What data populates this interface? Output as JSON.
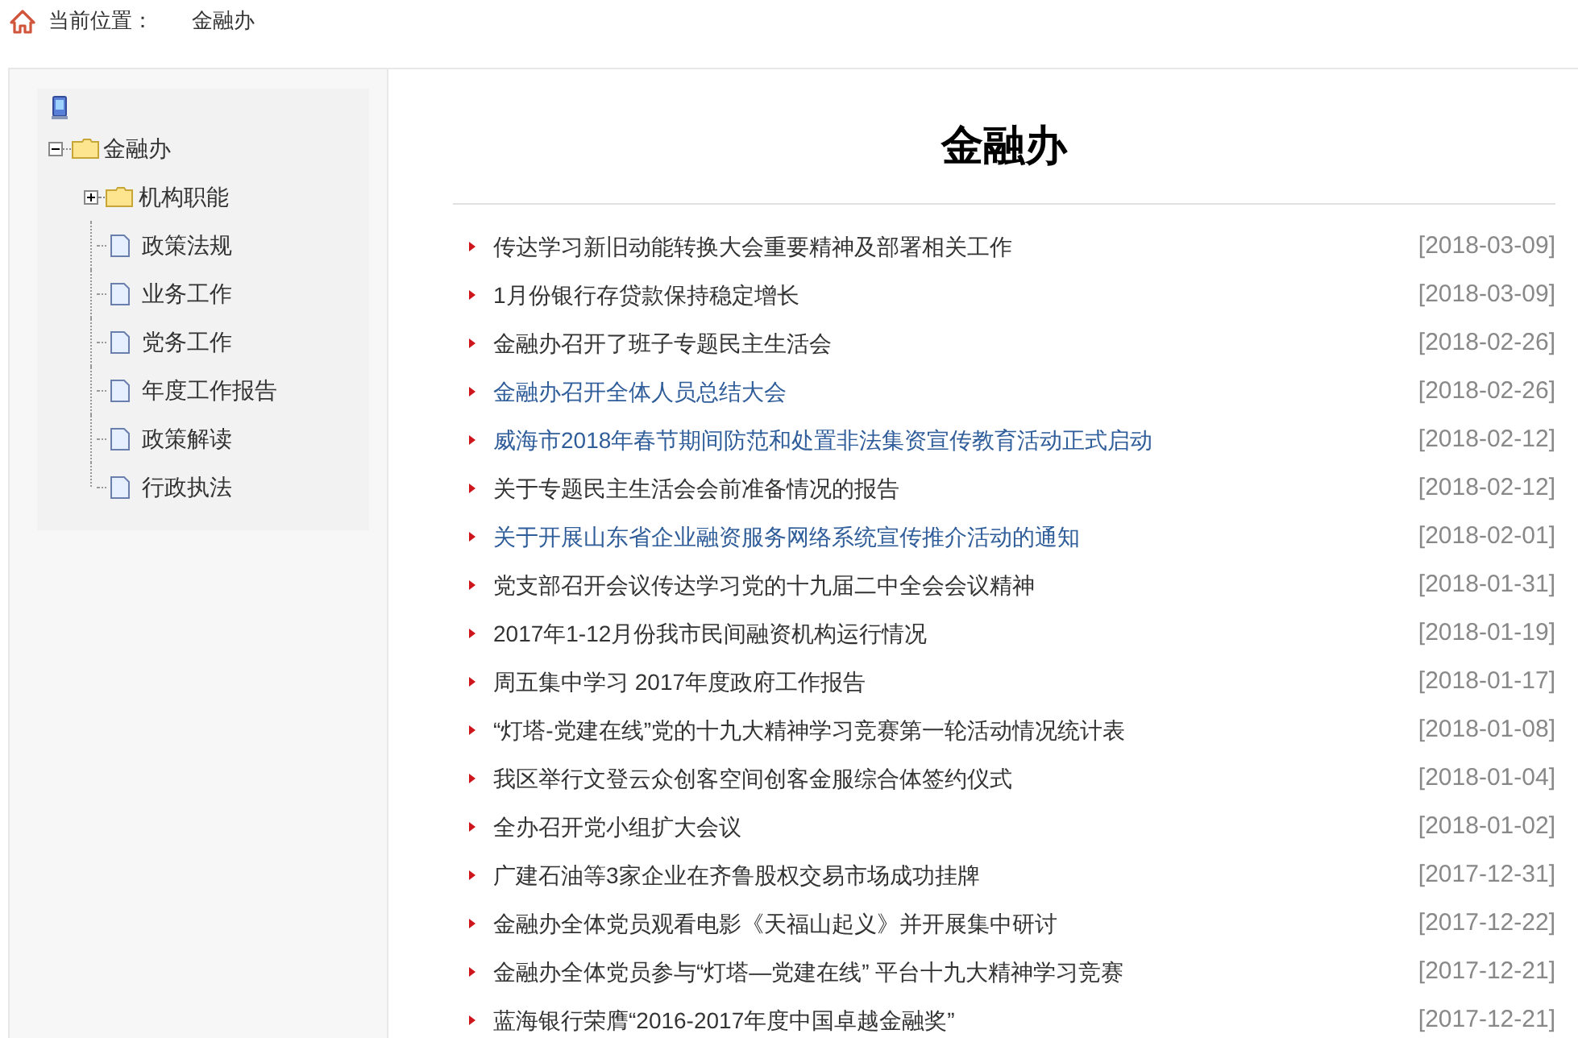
{
  "breadcrumb": {
    "label": "当前位置：",
    "current": "金融办"
  },
  "tree": {
    "label": "金融办",
    "expanded": true,
    "children": [
      {
        "label": "机构职能",
        "kind": "folder",
        "expanded": false
      },
      {
        "label": "政策法规",
        "kind": "page"
      },
      {
        "label": "业务工作",
        "kind": "page"
      },
      {
        "label": "党务工作",
        "kind": "page"
      },
      {
        "label": "年度工作报告",
        "kind": "page"
      },
      {
        "label": "政策解读",
        "kind": "page"
      },
      {
        "label": "行政执法",
        "kind": "page"
      }
    ]
  },
  "title": "金融办",
  "articles": [
    {
      "title": "传达学习新旧动能转换大会重要精神及部署相关工作",
      "date": "[2018-03-09]",
      "visited": false
    },
    {
      "title": "1月份银行存贷款保持稳定增长",
      "date": "[2018-03-09]",
      "visited": false
    },
    {
      "title": "金融办召开了班子专题民主生活会",
      "date": "[2018-02-26]",
      "visited": false
    },
    {
      "title": "金融办召开全体人员总结大会",
      "date": "[2018-02-26]",
      "visited": true
    },
    {
      "title": "威海市2018年春节期间防范和处置非法集资宣传教育活动正式启动",
      "date": "[2018-02-12]",
      "visited": true
    },
    {
      "title": "关于专题民主生活会会前准备情况的报告",
      "date": "[2018-02-12]",
      "visited": false
    },
    {
      "title": "关于开展山东省企业融资服务网络系统宣传推介活动的通知",
      "date": "[2018-02-01]",
      "visited": true
    },
    {
      "title": "党支部召开会议传达学习党的十九届二中全会会议精神",
      "date": "[2018-01-31]",
      "visited": false
    },
    {
      "title": "2017年1-12月份我市民间融资机构运行情况",
      "date": "[2018-01-19]",
      "visited": false
    },
    {
      "title": "周五集中学习 2017年度政府工作报告",
      "date": "[2018-01-17]",
      "visited": false
    },
    {
      "title": "“灯塔-党建在线”党的十九大精神学习竞赛第一轮活动情况统计表",
      "date": "[2018-01-08]",
      "visited": false
    },
    {
      "title": "我区举行文登云众创客空间创客金服综合体签约仪式",
      "date": "[2018-01-04]",
      "visited": false
    },
    {
      "title": "全办召开党小组扩大会议",
      "date": "[2018-01-02]",
      "visited": false
    },
    {
      "title": "广建石油等3家企业在齐鲁股权交易市场成功挂牌",
      "date": "[2017-12-31]",
      "visited": false
    },
    {
      "title": "金融办全体党员观看电影《天福山起义》并开展集中研讨",
      "date": "[2017-12-22]",
      "visited": false
    },
    {
      "title": "金融办全体党员参与“灯塔—党建在线” 平台十九大精神学习竞赛",
      "date": "[2017-12-21]",
      "visited": false
    },
    {
      "title": "蓝海银行荣膺“2016-2017年度中国卓越金融奖”",
      "date": "[2017-12-21]",
      "visited": false
    }
  ]
}
